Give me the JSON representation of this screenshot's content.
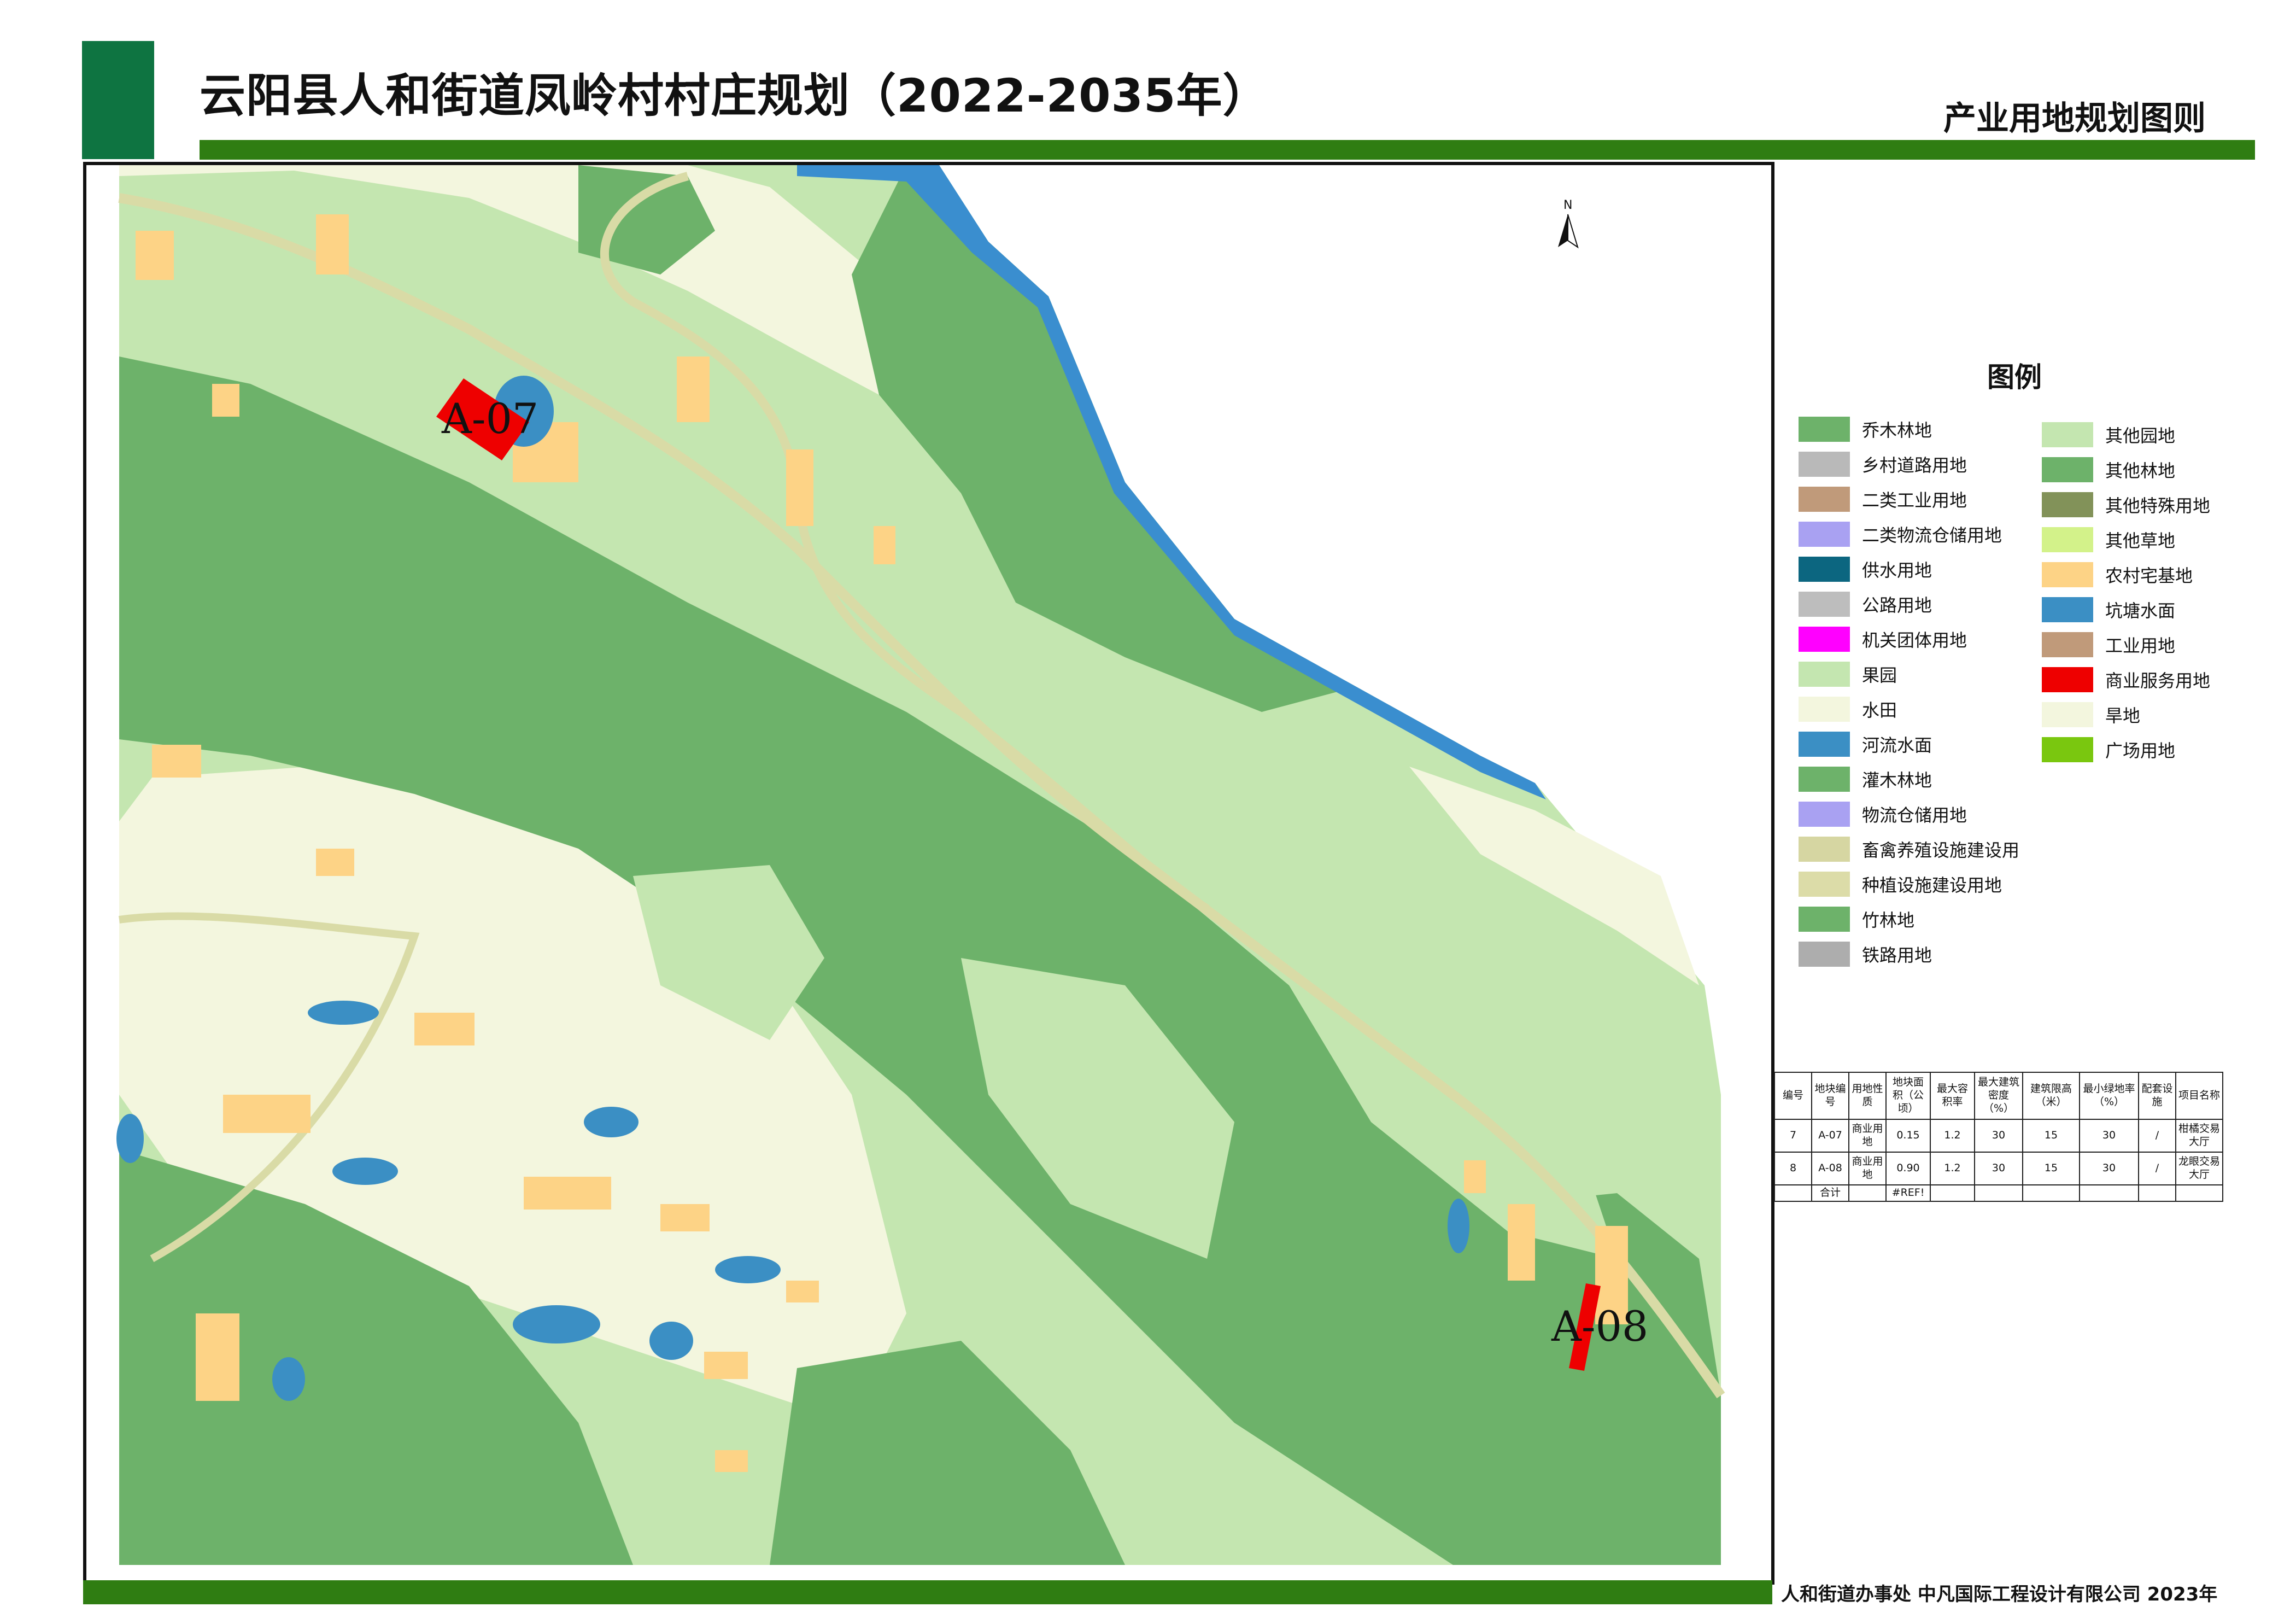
{
  "header": {
    "title": "云阳县人和街道凤岭村村庄规划（2022-2035年）",
    "subtitle": "产业用地规划图则"
  },
  "footer": {
    "credits": "人和街道办事处   中凡国际工程设计有限公司   2023年"
  },
  "map": {
    "north_label": "N",
    "sites": [
      {
        "id": "A-07",
        "label": "A-07",
        "land_use": "商业服务用地",
        "color": "#ee0000"
      },
      {
        "id": "A-08",
        "label": "A-08",
        "land_use": "商业服务用地",
        "color": "#ee0000"
      }
    ],
    "colors": {
      "forest": "#6db26a",
      "orchard": "#c4e6b0",
      "dryland": "#f3f6de",
      "homestead": "#fdd386",
      "water": "#3b8fc4",
      "river_edge": "#3a8ecf",
      "road": "#d9dba6"
    }
  },
  "legend": {
    "title": "图例",
    "left_items": [
      {
        "label": "乔木林地",
        "color": "#6db26a"
      },
      {
        "label": "乡村道路用地",
        "color": "#b9b9b9"
      },
      {
        "label": "二类工业用地",
        "color": "#c09a7a"
      },
      {
        "label": "二类物流仓储用地",
        "color": "#a9a1f2"
      },
      {
        "label": "供水用地",
        "color": "#0c6680"
      },
      {
        "label": "公路用地",
        "color": "#bdbdbd"
      },
      {
        "label": "机关团体用地",
        "color": "#ff00ff"
      },
      {
        "label": "果园",
        "color": "#c4e6b0"
      },
      {
        "label": "水田",
        "color": "#f3f6de"
      },
      {
        "label": "河流水面",
        "color": "#3b8fc4"
      },
      {
        "label": "灌木林地",
        "color": "#6db26a"
      },
      {
        "label": "物流仓储用地",
        "color": "#a9a1f2"
      },
      {
        "label": "畜禽养殖设施建设用",
        "color": "#d6d6a2"
      },
      {
        "label": "种植设施建设用地",
        "color": "#dcdca8"
      },
      {
        "label": "竹林地",
        "color": "#6db26a"
      },
      {
        "label": "铁路用地",
        "color": "#adadad"
      }
    ],
    "right_items": [
      {
        "label": "其他园地",
        "color": "#c4e6b0"
      },
      {
        "label": "其他林地",
        "color": "#6db26a"
      },
      {
        "label": "其他特殊用地",
        "color": "#829259"
      },
      {
        "label": "其他草地",
        "color": "#d3f28a"
      },
      {
        "label": "农村宅基地",
        "color": "#fdd386"
      },
      {
        "label": "坑塘水面",
        "color": "#3b8fc4"
      },
      {
        "label": "工业用地",
        "color": "#c09a7a"
      },
      {
        "label": "商业服务用地",
        "color": "#ee0000"
      },
      {
        "label": "旱地",
        "color": "#f3f6de"
      },
      {
        "label": "广场用地",
        "color": "#7ac70f"
      }
    ]
  },
  "table": {
    "headers": [
      "编号",
      "地块编号",
      "用地性质",
      "地块面积（公顷）",
      "最大容积率",
      "最大建筑密度（%）",
      "建筑限高（米）",
      "最小绿地率（%）",
      "配套设施",
      "项目名称"
    ],
    "rows": [
      [
        "7",
        "A-07",
        "商业用地",
        "0.15",
        "1.2",
        "30",
        "15",
        "30",
        "/",
        "柑橘交易大厅"
      ],
      [
        "8",
        "A-08",
        "商业用地",
        "0.90",
        "1.2",
        "30",
        "15",
        "30",
        "/",
        "龙眼交易大厅"
      ]
    ],
    "total_label": "合计",
    "total_value": "#REF!"
  }
}
